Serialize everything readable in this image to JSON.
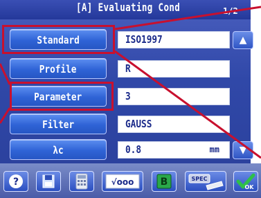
{
  "header": {
    "title": "[A] Evaluating Cond",
    "page_indicator": "1/2"
  },
  "rows": [
    {
      "label": "Standard",
      "value": "ISO1997"
    },
    {
      "label": "Profile",
      "value": "R"
    },
    {
      "label": "Parameter",
      "value": "3"
    },
    {
      "label": "Filter",
      "value": "GAUSS"
    },
    {
      "label": "λc",
      "value": "0.8",
      "unit": "mm"
    }
  ],
  "toolbar": {
    "buttons": [
      {
        "icon": "help-icon",
        "text": "?"
      },
      {
        "icon": "save-icon",
        "text": ""
      },
      {
        "icon": "calculator-icon",
        "text": ""
      },
      {
        "icon": "sqrt-icon",
        "text": "√ooo"
      },
      {
        "icon": "b-icon",
        "text": "B"
      },
      {
        "icon": "spec-icon",
        "text": "SPEC"
      },
      {
        "icon": "ok-icon",
        "text": "OK"
      }
    ]
  },
  "colors": {
    "highlight": "#c8102e",
    "panel": "#3048a8",
    "button": "#2f63d6"
  }
}
